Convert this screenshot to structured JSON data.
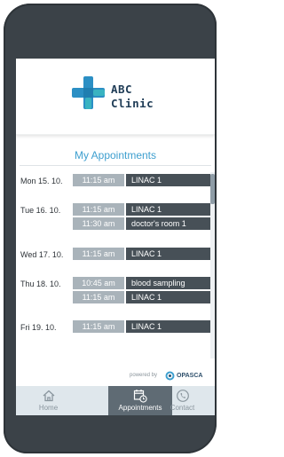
{
  "app": {
    "logo_line1": "ABC",
    "logo_line2": "Clinic"
  },
  "page": {
    "title": "My Appointments"
  },
  "days": [
    {
      "label": "Mon 15. 10.",
      "appointments": [
        {
          "time": "11:15 am",
          "place": "LINAC 1"
        }
      ]
    },
    {
      "label": "Tue 16. 10.",
      "appointments": [
        {
          "time": "11:15 am",
          "place": "LINAC 1"
        },
        {
          "time": "11:30 am",
          "place": "doctor's room 1"
        }
      ]
    },
    {
      "label": "Wed 17. 10.",
      "appointments": [
        {
          "time": "11:15 am",
          "place": "LINAC 1"
        }
      ]
    },
    {
      "label": "Thu 18. 10.",
      "appointments": [
        {
          "time": "10:45 am",
          "place": "blood sampling"
        },
        {
          "time": "11:15 am",
          "place": "LINAC 1"
        }
      ]
    },
    {
      "label": "Fri 19. 10.",
      "appointments": [
        {
          "time": "11:15 am",
          "place": "LINAC 1"
        }
      ]
    }
  ],
  "footer": {
    "powered_by": "powered by",
    "brand": "OPASCA"
  },
  "tabs": [
    {
      "label": "Home",
      "icon": "home-icon",
      "active": false
    },
    {
      "label": "Appointments",
      "icon": "calendar-clock-icon",
      "active": true
    },
    {
      "label": "Contact",
      "icon": "phone-icon",
      "active": false
    }
  ],
  "colors": {
    "device_frame": "#3b4248",
    "title_blue": "#3e9fcf",
    "logo_cross_blue": "#2b8fc4",
    "logo_cross_teal": "#39b3c1",
    "time_cell": "#a9b3ba",
    "place_cell": "#475057",
    "tabbar": "#dfe7ec",
    "tab_active": "#5f6b74"
  }
}
